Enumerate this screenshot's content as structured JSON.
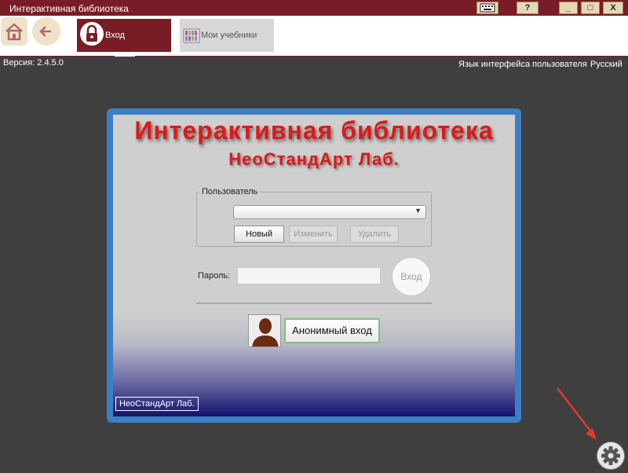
{
  "window": {
    "title": "Интерактивная библиотека",
    "buttons": {
      "help": "?",
      "minimize": "_",
      "maximize": "□",
      "close": "X"
    }
  },
  "toolbar": {
    "tabs": [
      {
        "label": "Вход",
        "icon": "lock-icon",
        "active": true
      },
      {
        "label": "Мои учебники",
        "icon": "books-icon",
        "active": false
      }
    ]
  },
  "info": {
    "version": "Версия: 2.4.5.0",
    "language_label": "Язык интерфейса пользователя",
    "language_value": "Русский"
  },
  "dialog": {
    "title": "Интерактивная библиотека",
    "subtitle": "НеоСтандАрт Лаб.",
    "user_group_label": "Пользователь",
    "user_selected": "",
    "buttons": {
      "new": "Новый",
      "edit": "Изменить",
      "delete": "Удалить",
      "login": "Вход",
      "anonymous": "Анонимный вход"
    },
    "password_label": "Пароль:",
    "password_value": "",
    "brand": "НеоСтандАрт Лаб."
  },
  "colors": {
    "titlebar": "#7a1c25",
    "accent_red": "#e01818",
    "frame_blue": "#3c7fc4",
    "background": "#3f3f3f",
    "annotation": "#e03a2e"
  }
}
